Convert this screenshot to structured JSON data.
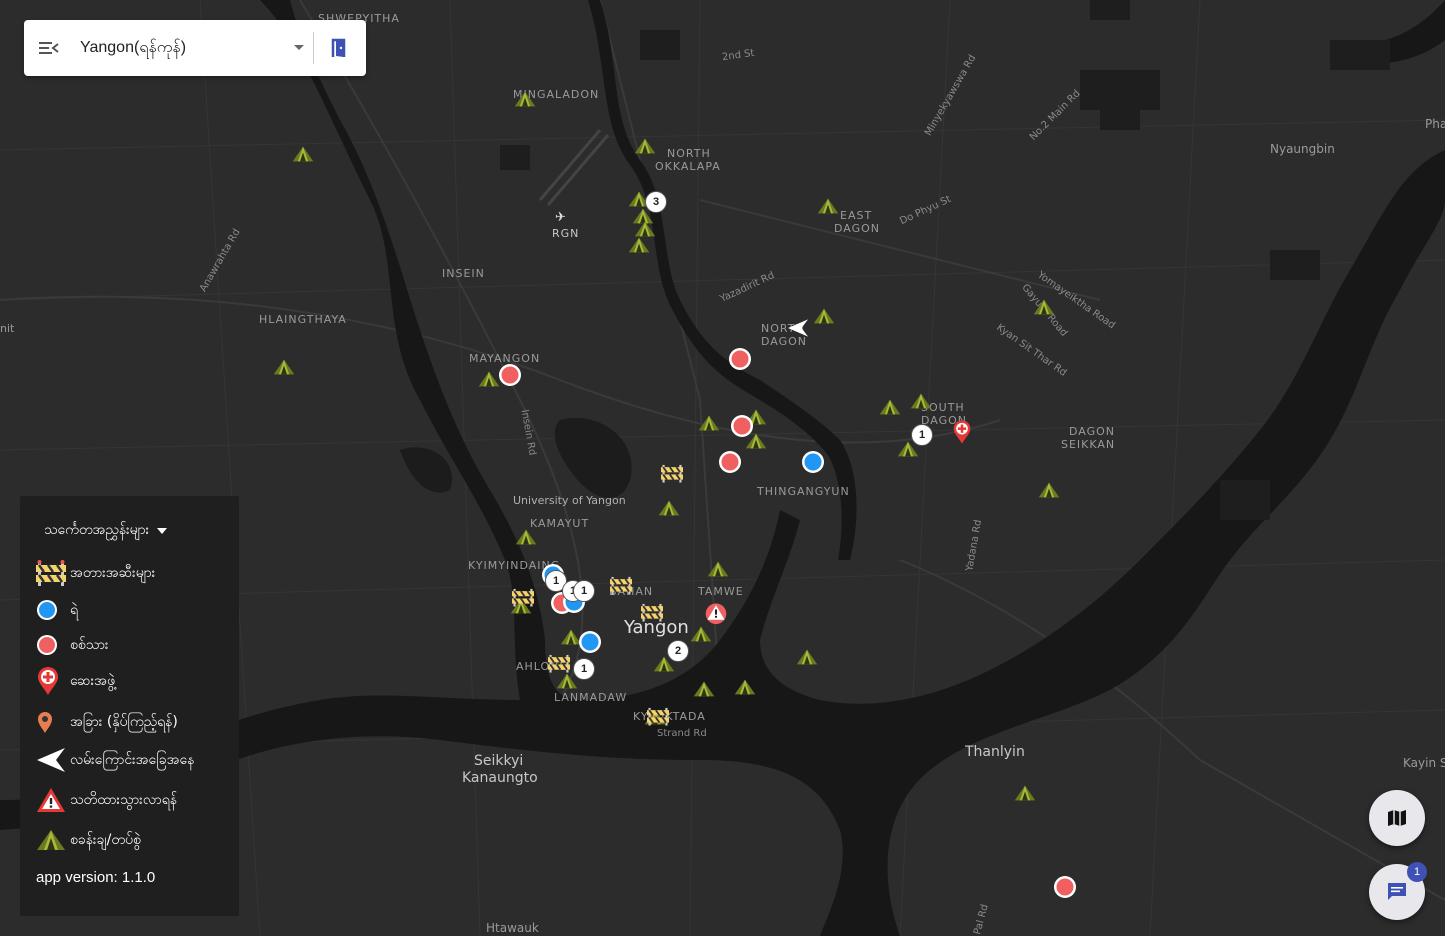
{
  "header": {
    "city": "Yangon(ရန်ကုန်)"
  },
  "legend": {
    "title": "သင်္ကေတအညွှန်းများ",
    "items": [
      {
        "icon": "barrier-icon",
        "label": "အတားအဆီးများ"
      },
      {
        "icon": "police-icon",
        "label": "ရဲ"
      },
      {
        "icon": "military-icon",
        "label": "စစ်သား"
      },
      {
        "icon": "medical-icon",
        "label": "ဆေးအဖွဲ့"
      },
      {
        "icon": "other-pin-icon",
        "label": "အခြား (နှိပ်ကြည့်ရန်)"
      },
      {
        "icon": "direction-arrow-icon",
        "label": "လမ်းကြောင်းအခြေအနေ"
      },
      {
        "icon": "warning-icon",
        "label": "သတိထားသွားလာရန်"
      },
      {
        "icon": "camp-icon",
        "label": "စခန်းချ/တပ်စွဲ"
      }
    ],
    "version": "app version: 1.1.0"
  },
  "chat": {
    "badge": "1"
  },
  "map_labels": {
    "shwepyitha": "SHWEPYITHA",
    "mingaladon": "MINGALADON",
    "north_okkalapa_1": "NORTH",
    "north_okkalapa_2": "OKKALAPA",
    "rgn": "RGN",
    "insein": "INSEIN",
    "hlaingthaya": "HLAINGTHAYA",
    "mayangon": "MAYANGON",
    "east_dagon_1": "EAST",
    "east_dagon_2": "DAGON",
    "north_dagon_1": "NORTH",
    "north_dagon_2": "DAGON",
    "south_dagon_1": "SOUTH",
    "south_dagon_2": "DAGON",
    "dagon_seikkan_1": "DAGON",
    "dagon_seikkan_2": "SEIKKAN",
    "thingangyun": "THINGANGYUN",
    "university": "University of Yangon",
    "kamayut": "KAMAYUT",
    "kyimyindaing": "KYIMYINDAING",
    "bahan": "BAHAN",
    "tamwe": "TAMWE",
    "yangon": "Yangon",
    "ahlone": "AHLONE",
    "lanmadaw": "LANMADAW",
    "kyauktada": "KYAUKTADA",
    "seikkyi_1": "Seikkyi",
    "seikkyi_2": "Kanaungto",
    "thanlyin": "Thanlyin",
    "nyaungbin": "Nyaungbin",
    "kayin": "Kayin Se",
    "htawauk": "Htawauk",
    "pha": "Pha",
    "nit": "nit"
  },
  "roads": {
    "2nd_st": "2nd St",
    "minyekyawswa": "Minyekyawswa Rd",
    "no2main": "No.2 Main Rd",
    "anawrahta": "Anawrahta Rd",
    "dophyu": "Do Phyu St",
    "yazadirit": "Yazadirit Rd",
    "yomayeiktha": "Yomayeiktha Road",
    "gayunt": "Gayunt Road",
    "kyansitthar": "Kyan Sit Thar Rd",
    "insein_rd": "Insein Rd",
    "yadana": "Yadana Rd",
    "strand": "Strand Rd",
    "pal": "Pal Rd"
  },
  "clusters": {
    "c1": "3",
    "c2": "1",
    "c3": "1",
    "c4": "1",
    "c5": "1",
    "c6": "2",
    "c7": "1"
  },
  "colors": {
    "map_bg": "#2b2b2b",
    "water": "#171717",
    "police": "#2196f3",
    "military": "#f06060",
    "camp": "#8a9a2a",
    "legend_bg": "#1f1f1f",
    "accent": "#3f51b5"
  }
}
